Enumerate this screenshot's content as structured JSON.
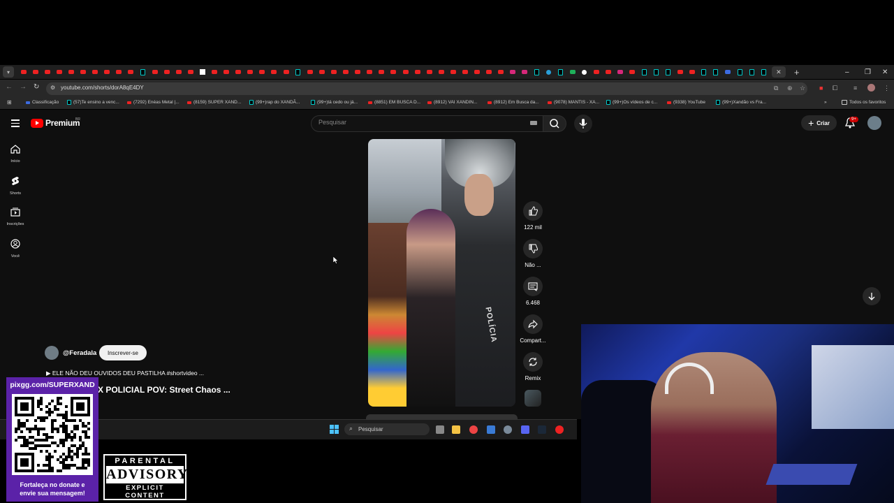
{
  "browser": {
    "url": "youtube.com/shorts/dorA8qE4DY",
    "tab_favicons": [
      "yt",
      "yt",
      "yt",
      "yt",
      "yt",
      "yt",
      "yt",
      "yt",
      "yt",
      "yt",
      "tt",
      "yt",
      "yt",
      "yt",
      "yt",
      "wh",
      "yt",
      "yt",
      "yt",
      "yt",
      "yt",
      "yt",
      "yt",
      "tt",
      "yt",
      "yt",
      "yt",
      "yt",
      "yt",
      "yt",
      "yt",
      "yt",
      "yt",
      "yt",
      "yt",
      "yt",
      "yt",
      "yt",
      "yt",
      "yt",
      "yt",
      "ig",
      "ig",
      "tt",
      "tg",
      "tt",
      "gr",
      "gg",
      "yt",
      "yt",
      "ig",
      "yt",
      "tt",
      "tt",
      "tt",
      "yt",
      "yt",
      "tt",
      "tt",
      "bl",
      "tt",
      "tt",
      "tt"
    ],
    "new_tab_label": "+",
    "close_tab_label": "✕",
    "bookmarks": [
      {
        "label": "Classificação",
        "icon": "bl"
      },
      {
        "label": "(57)Te ensino a venc...",
        "icon": "tt"
      },
      {
        "label": "(7292) Enéas Metal |...",
        "icon": "yt"
      },
      {
        "label": "(8159) SUPER XAND...",
        "icon": "yt"
      },
      {
        "label": "(99+)rap do XANDÃ...",
        "icon": "tt"
      },
      {
        "label": "(99+)tá cedo ou já...",
        "icon": "tt"
      },
      {
        "label": "(8851) EM BUSCA D...",
        "icon": "yt"
      },
      {
        "label": "(8912) VAI XANDIN...",
        "icon": "yt"
      },
      {
        "label": "(8912) Em Busca da...",
        "icon": "yt"
      },
      {
        "label": "(9078) MANTIS - XA...",
        "icon": "yt"
      },
      {
        "label": "(99+)Os vídeos de c...",
        "icon": "tt"
      },
      {
        "label": "(9338) YouTube",
        "icon": "yt"
      },
      {
        "label": "(99+)Xandão vs Fra...",
        "icon": "tt"
      }
    ],
    "bookmarks_more": "»",
    "all_bookmarks": "Todos os favoritos"
  },
  "youtube": {
    "logo_text": "Premium",
    "logo_region": "BR",
    "search_placeholder": "Pesquisar",
    "create_label": "Criar",
    "notifications_badge": "9+",
    "sidenav": [
      {
        "label": "Início",
        "icon": "home-icon"
      },
      {
        "label": "Shorts",
        "icon": "shorts-icon"
      },
      {
        "label": "Inscrições",
        "icon": "subscriptions-icon"
      },
      {
        "label": "Você",
        "icon": "you-icon"
      }
    ],
    "short": {
      "channel": "@Feradala",
      "subscribe_label": "Inscrever-se",
      "audio_text": "▶ ELE NÃO DEU OUVIDOS DEU PASTILHA #shortvideo ...",
      "title": "X POLICIAL POV: Street Chaos  ...",
      "in_video_text": "POLÍCIA",
      "likes": "122 mil",
      "dislike_label": "Não ...",
      "comments": "6.468",
      "share_label": "Compart...",
      "remix_label": "Remix"
    }
  },
  "taskbar": {
    "search_placeholder": "Pesquisar"
  },
  "overlay": {
    "donate_url": "pixgg.com/SUPERXAND",
    "donate_message_line1": "Fortaleça no donate e",
    "donate_message_line2": "envie sua mensagem!",
    "parental_line1": "PARENTAL",
    "parental_line2": "ADVISORY",
    "parental_line3": "EXPLICIT CONTENT"
  }
}
